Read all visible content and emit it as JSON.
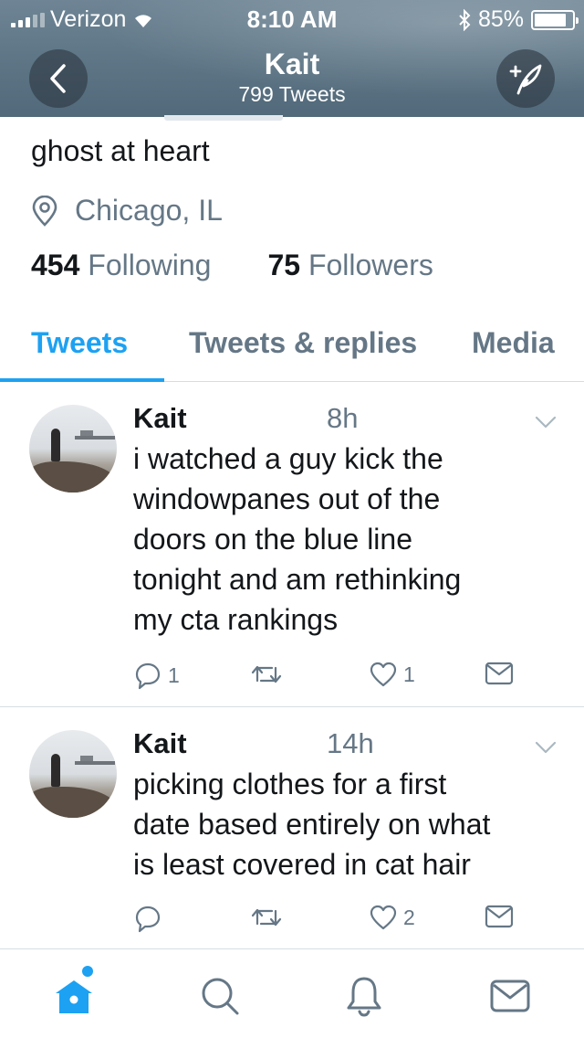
{
  "status_bar": {
    "carrier": "Verizon",
    "time": "8:10 AM",
    "battery_percent": "85%",
    "battery_level": 0.85
  },
  "header": {
    "title": "Kait",
    "subtitle": "799 Tweets"
  },
  "profile": {
    "bio": "ghost at heart",
    "location": "Chicago, IL",
    "following_count": "454",
    "following_label": "Following",
    "followers_count": "75",
    "followers_label": "Followers"
  },
  "tabs": [
    {
      "label": "Tweets",
      "active": true
    },
    {
      "label": "Tweets & replies",
      "active": false
    },
    {
      "label": "Media",
      "active": false
    }
  ],
  "tweets": [
    {
      "name": "Kait",
      "time": "8h",
      "text_lines": [
        "i watched a guy kick the",
        "windowpanes out of the",
        "doors on the blue line",
        "tonight and am rethinking",
        "my cta rankings"
      ],
      "reply_count": "1",
      "retweet_count": "",
      "like_count": "1"
    },
    {
      "name": "Kait",
      "time": "14h",
      "text_lines": [
        "picking clothes for a first",
        "date based entirely on what",
        "is least covered in cat hair"
      ],
      "reply_count": "",
      "retweet_count": "",
      "like_count": "2"
    }
  ],
  "bottom_nav": [
    {
      "icon": "home-icon",
      "active": true
    },
    {
      "icon": "search-icon",
      "active": false
    },
    {
      "icon": "notifications-icon",
      "active": false
    },
    {
      "icon": "messages-icon",
      "active": false
    }
  ],
  "colors": {
    "accent": "#1da1f2",
    "secondary_text": "#657786",
    "primary_text": "#14171a",
    "divider": "#d6dde3"
  }
}
